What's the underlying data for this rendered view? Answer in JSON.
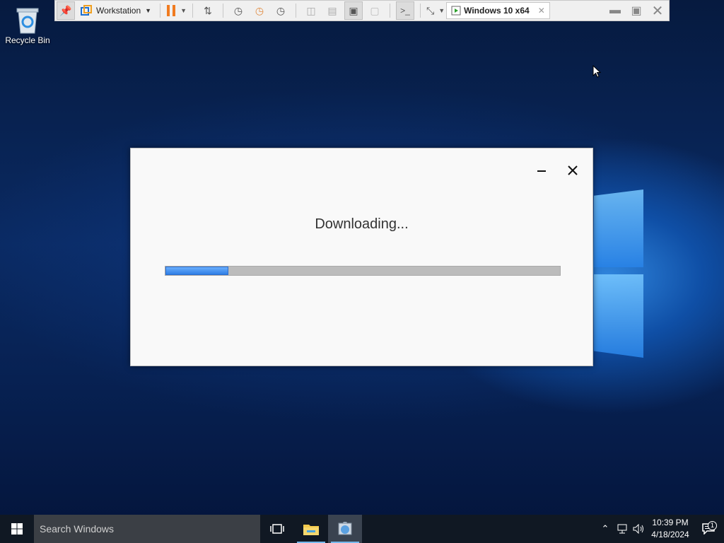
{
  "desktop": {
    "icons": [
      {
        "label": "Recycle Bin",
        "icon": "recycle-bin-icon"
      }
    ]
  },
  "vmware_toolbar": {
    "menu_label": "Workstation",
    "vm_tab_label": "Windows 10 x64",
    "buttons": [
      "pin-icon",
      "pause-icon",
      "send-ctrl-alt-del-icon",
      "snapshot-icon",
      "revert-snapshot-icon",
      "snapshot-manager-icon",
      "view-sidebar-icon",
      "view-thumbnail-icon",
      "fit-guest-icon",
      "unity-icon",
      "console-icon",
      "full-screen-icon"
    ]
  },
  "dialog": {
    "title": "Downloading...",
    "progress": 0.16,
    "minimize_icon": "minimize-icon",
    "close_icon": "close-icon"
  },
  "taskbar": {
    "search_placeholder": "Search Windows",
    "time": "10:39 PM",
    "date": "4/18/2024",
    "notification_count": "1"
  },
  "colors": {
    "accent": "#2f7fe6",
    "taskbar": "#101823",
    "desktop": "#0a2a63"
  }
}
